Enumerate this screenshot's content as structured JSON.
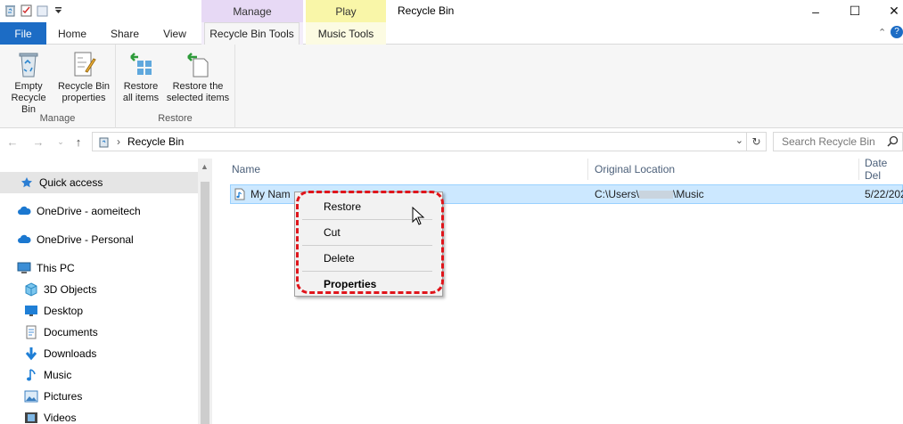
{
  "window": {
    "title": "Recycle Bin",
    "minimize": "–",
    "maximize": "☐",
    "close": "✕"
  },
  "contextual_tab_groups": [
    {
      "label": "Manage",
      "color": "#e7d9f5"
    },
    {
      "label": "Play",
      "color": "#f9f6a8"
    }
  ],
  "tabs": {
    "file": "File",
    "home": "Home",
    "share": "Share",
    "view": "View",
    "recycle_bin_tools": "Recycle Bin Tools",
    "music_tools": "Music Tools"
  },
  "ribbon": {
    "manage_group": {
      "label": "Manage",
      "empty_line1": "Empty",
      "empty_line2": "Recycle Bin",
      "props_line1": "Recycle Bin",
      "props_line2": "properties"
    },
    "restore_group": {
      "label": "Restore",
      "restore_all_line1": "Restore",
      "restore_all_line2": "all items",
      "restore_sel_line1": "Restore the",
      "restore_sel_line2": "selected items"
    }
  },
  "address": {
    "separator": "›",
    "location": "Recycle Bin",
    "search_placeholder": "Search Recycle Bin"
  },
  "nav": {
    "items": [
      {
        "label": "Quick access",
        "icon": "star-icon"
      },
      {
        "label": "OneDrive - aomeitech",
        "icon": "cloud-icon"
      },
      {
        "label": "OneDrive - Personal",
        "icon": "cloud-icon"
      },
      {
        "label": "This PC",
        "icon": "computer-icon"
      },
      {
        "label": "3D Objects",
        "icon": "cube-icon"
      },
      {
        "label": "Desktop",
        "icon": "desktop-icon"
      },
      {
        "label": "Documents",
        "icon": "documents-icon"
      },
      {
        "label": "Downloads",
        "icon": "download-icon"
      },
      {
        "label": "Music",
        "icon": "music-icon"
      },
      {
        "label": "Pictures",
        "icon": "pictures-icon"
      },
      {
        "label": "Videos",
        "icon": "videos-icon"
      }
    ]
  },
  "columns": {
    "name": "Name",
    "original_location": "Original Location",
    "date_deleted": "Date Del"
  },
  "file": {
    "name": "My Nam",
    "original_location_prefix": "C:\\Users\\",
    "original_location_suffix": "\\Music",
    "date_deleted": "5/22/202"
  },
  "context_menu": {
    "items": [
      "Restore",
      "Cut",
      "Delete",
      "Properties"
    ]
  },
  "colors": {
    "file_tab": "#1c6cc5",
    "selection": "#cce8ff",
    "highlight": "#e0151b"
  }
}
